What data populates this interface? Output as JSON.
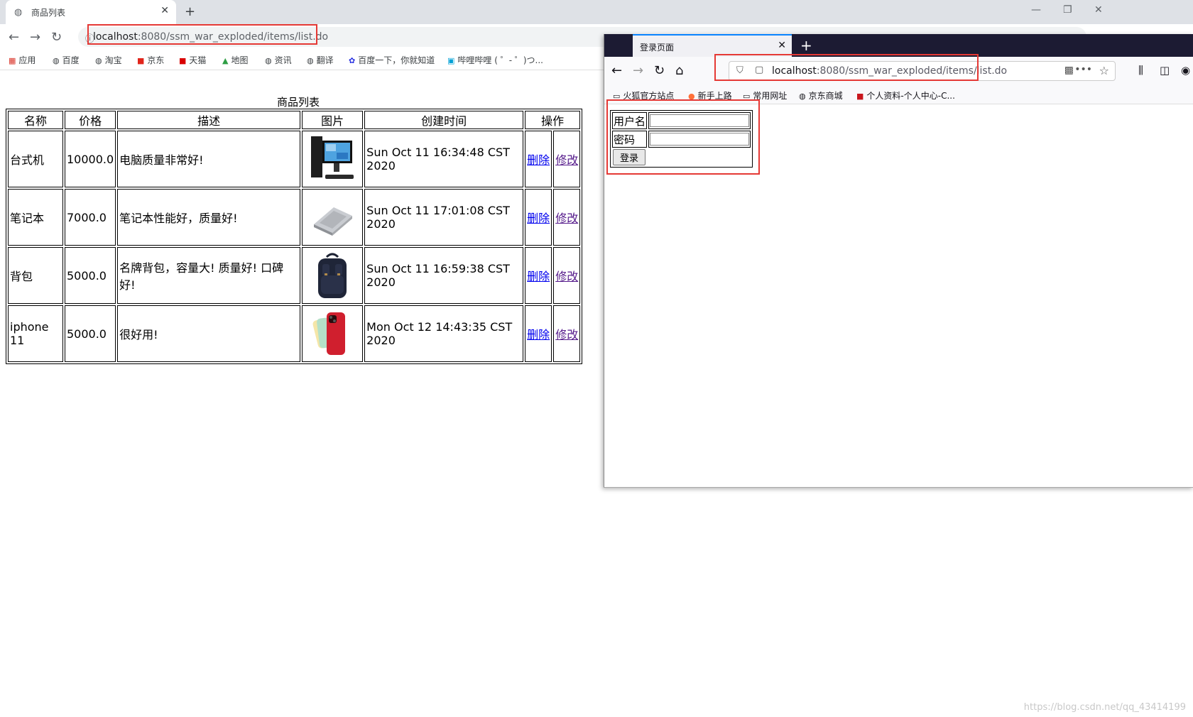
{
  "chrome": {
    "tab_title": "商品列表",
    "url_host": "localhost",
    "url_path": ":8080/ssm_war_exploded/items/list.do",
    "bookmarks": [
      "应用",
      "百度",
      "淘宝",
      "京东",
      "天猫",
      "地图",
      "资讯",
      "翻译",
      "百度一下，你就知道",
      "哔哩哔哩 ( ゜- ゜)つ..."
    ]
  },
  "page": {
    "caption": "商品列表",
    "headers": [
      "名称",
      "价格",
      "描述",
      "图片",
      "创建时间",
      "操作"
    ],
    "rows": [
      {
        "name": "台式机",
        "price": "10000.0",
        "desc": "电脑质量非常好!",
        "time": "Sun Oct 11 16:34:48 CST 2020",
        "del": "删除",
        "edit": "修改",
        "thumb": "desktop-computer-image"
      },
      {
        "name": "笔记本",
        "price": "7000.0",
        "desc": "笔记本性能好，质量好!",
        "time": "Sun Oct 11 17:01:08 CST 2020",
        "del": "删除",
        "edit": "修改",
        "thumb": "laptop-image"
      },
      {
        "name": "背包",
        "price": "5000.0",
        "desc": "名牌背包，容量大! 质量好! 口碑好!",
        "time": "Sun Oct 11 16:59:38 CST 2020",
        "del": "删除",
        "edit": "修改",
        "thumb": "backpack-image"
      },
      {
        "name": "iphone 11",
        "price": "5000.0",
        "desc": "很好用!",
        "time": "Mon Oct 12 14:43:35 CST 2020",
        "del": "删除",
        "edit": "修改",
        "thumb": "iphone-image"
      }
    ],
    "watermark": "https://blog.csdn.net/qq_43414199"
  },
  "firefox": {
    "tab_title": "登录页面",
    "url_host": "localhost",
    "url_path": ":8080/ssm_war_exploded/items/list.do",
    "bookmarks": [
      "火狐官方站点",
      "新手上路",
      "常用网址",
      "京东商城",
      "个人资料-个人中心-C..."
    ],
    "login": {
      "username_label": "用户名",
      "password_label": "密码",
      "submit_label": "登录",
      "username_value": "",
      "password_value": ""
    }
  }
}
